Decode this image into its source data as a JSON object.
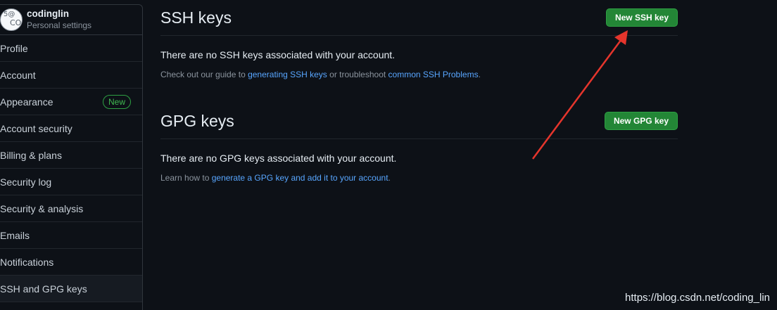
{
  "sidebar": {
    "avatar_text_top": "5@",
    "avatar_text_bottom": "CO",
    "username": "codinglin",
    "subtitle": "Personal settings",
    "items": [
      {
        "label": "Profile"
      },
      {
        "label": "Account"
      },
      {
        "label": "Appearance",
        "badge": "New"
      },
      {
        "label": "Account security"
      },
      {
        "label": "Billing & plans"
      },
      {
        "label": "Security log"
      },
      {
        "label": "Security & analysis"
      },
      {
        "label": "Emails"
      },
      {
        "label": "Notifications"
      },
      {
        "label": "SSH and GPG keys",
        "active": true
      }
    ]
  },
  "ssh": {
    "title": "SSH keys",
    "new_button": "New SSH key",
    "empty": "There are no SSH keys associated with your account.",
    "help_prefix": "Check out our guide to ",
    "help_link1": "generating SSH keys",
    "help_middle": " or troubleshoot ",
    "help_link2": "common SSH Problems",
    "help_suffix": "."
  },
  "gpg": {
    "title": "GPG keys",
    "new_button": "New GPG key",
    "empty": "There are no GPG keys associated with your account.",
    "help_prefix": "Learn how to ",
    "help_link": "generate a GPG key and add it to your account",
    "help_suffix": "."
  },
  "watermark": "https://blog.csdn.net/coding_lin",
  "colors": {
    "background": "#0d1117",
    "button_green": "#238636",
    "link_blue": "#58a6ff",
    "annotation_arrow": "#e5352c"
  }
}
